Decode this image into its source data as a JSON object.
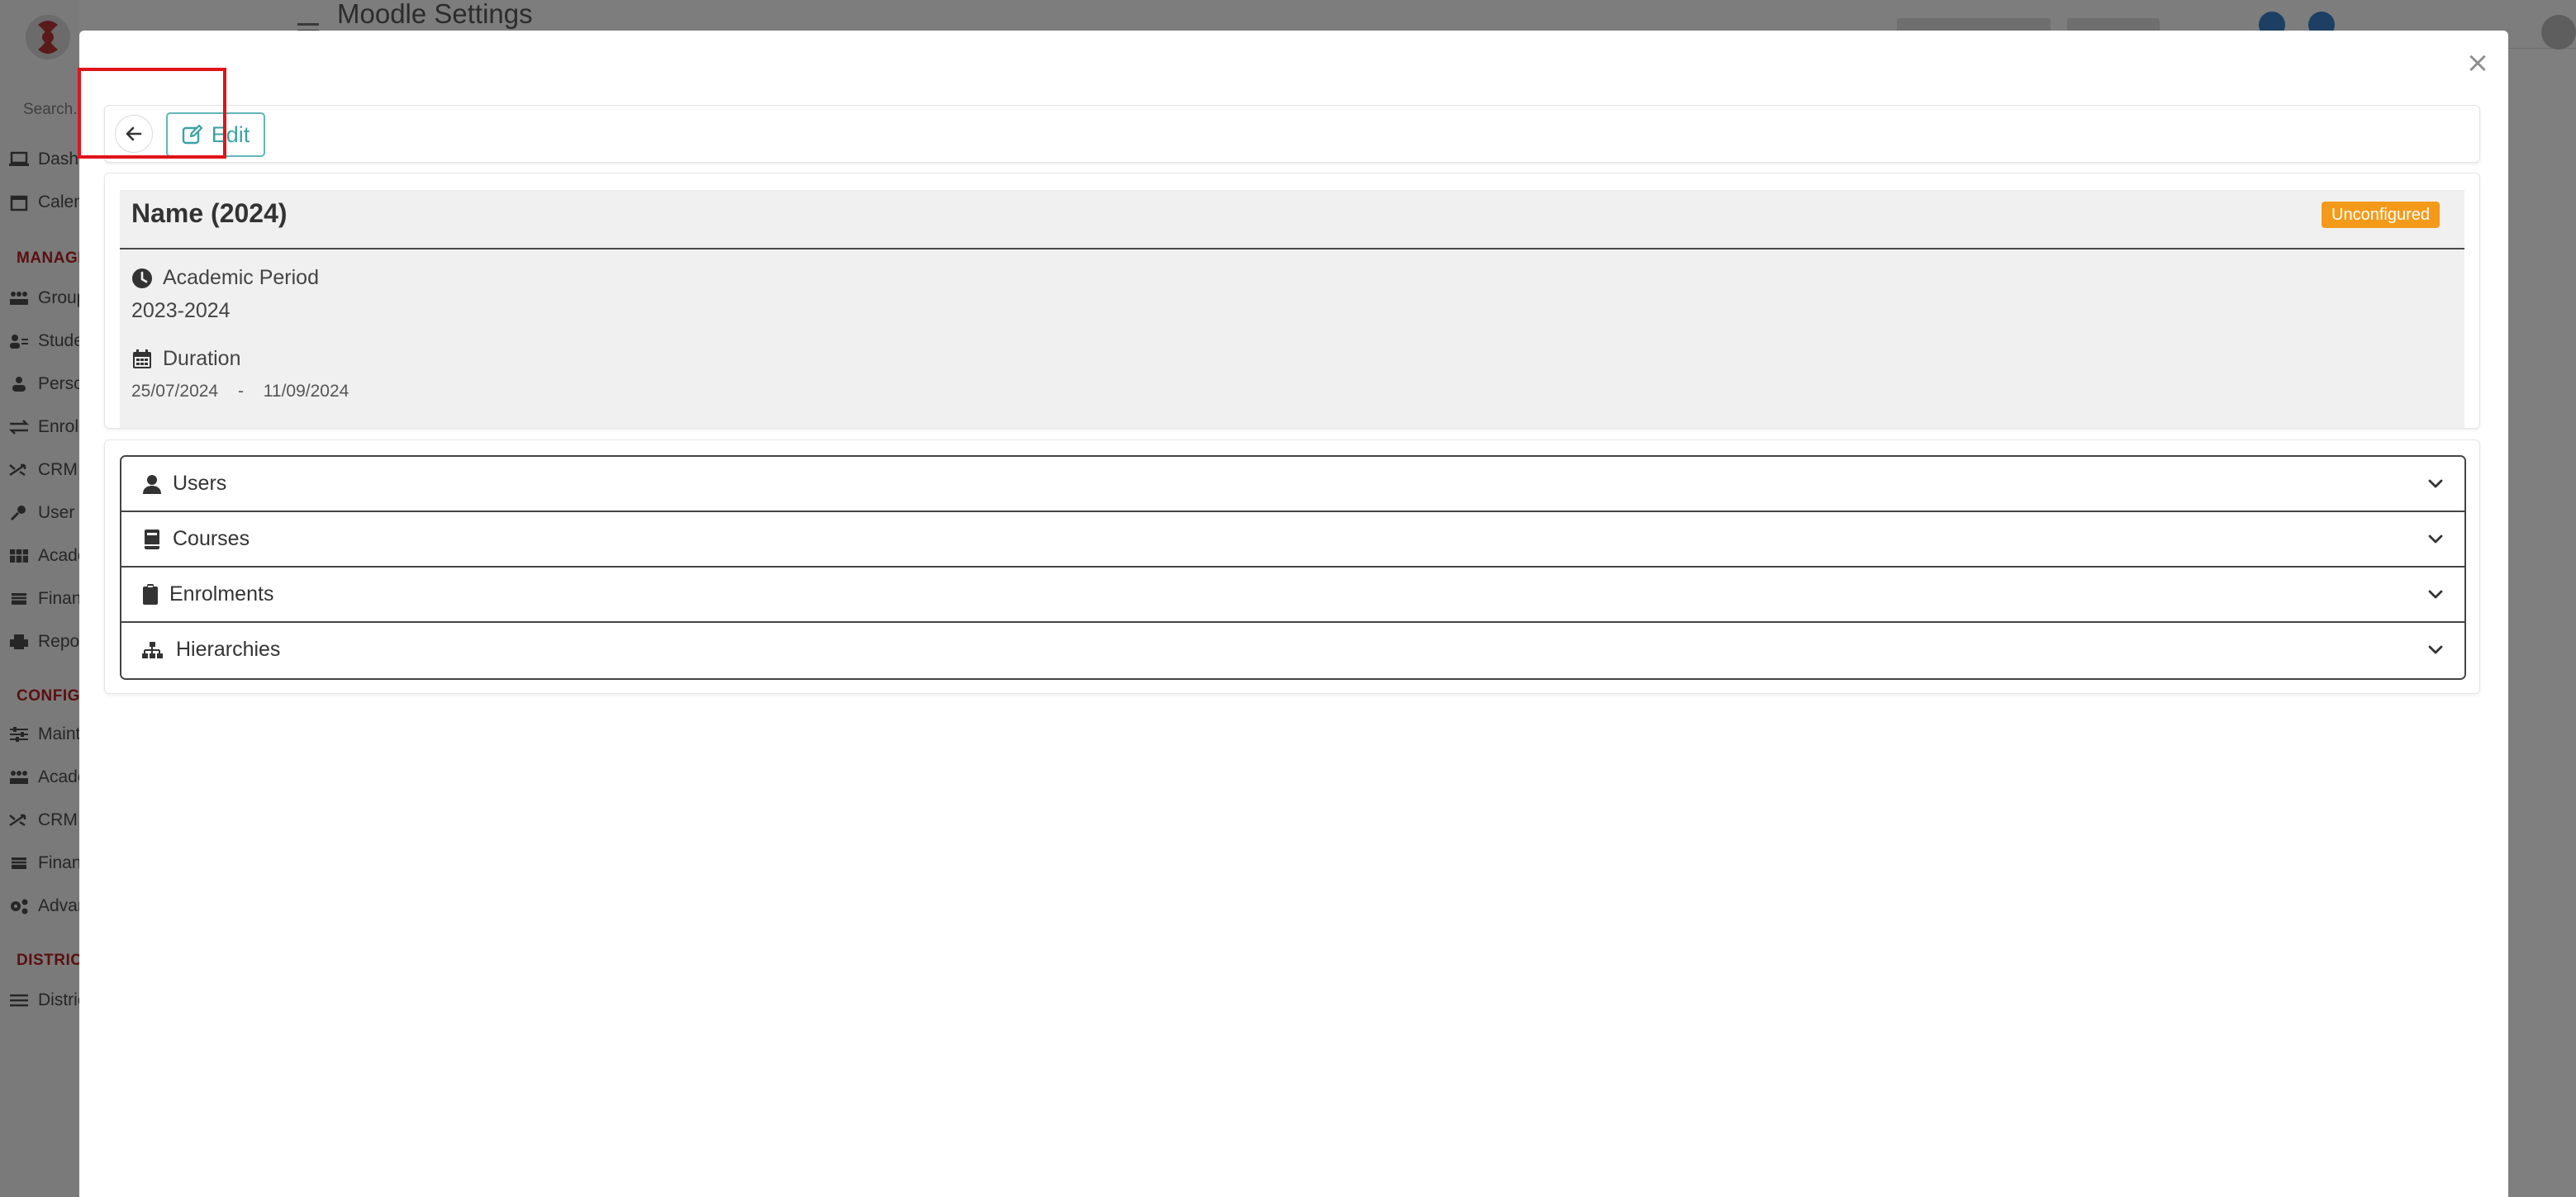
{
  "background": {
    "page_title": "Moodle Settings",
    "search_placeholder": "Search...",
    "nav_items": [
      {
        "label": "Dashboard",
        "icon": "laptop-icon"
      },
      {
        "label": "Calendar",
        "icon": "calendar-icon"
      },
      {
        "label": "Groups",
        "icon": "groups-icon"
      },
      {
        "label": "Students",
        "icon": "students-icon"
      },
      {
        "label": "Persons",
        "icon": "persons-icon"
      },
      {
        "label": "Enrolments",
        "icon": "exchange-icon"
      },
      {
        "label": "CRM",
        "icon": "shuffle-icon"
      },
      {
        "label": "User",
        "icon": "key-icon"
      },
      {
        "label": "Academic",
        "icon": "table-icon"
      },
      {
        "label": "Finance",
        "icon": "cash-icon"
      },
      {
        "label": "Reports",
        "icon": "printer-icon"
      },
      {
        "label": "Maintenance",
        "icon": "sliders-icon"
      },
      {
        "label": "Academic",
        "icon": "groups-icon"
      },
      {
        "label": "CRM",
        "icon": "shuffle-icon"
      },
      {
        "label": "Finance",
        "icon": "cash-icon"
      },
      {
        "label": "Advanced",
        "icon": "cogs-icon"
      },
      {
        "label": "Districts",
        "icon": "list-icon"
      }
    ],
    "sections": [
      "MANAGE",
      "CONFIG",
      "DISTRICTS"
    ]
  },
  "modal": {
    "close_glyph": "×",
    "toolbar": {
      "back_icon": "arrow-left-icon",
      "edit_label": "Edit",
      "edit_icon": "edit-icon"
    },
    "details": {
      "title": "Name (2024)",
      "status": "Unconfigured",
      "status_color": "#f49a1a",
      "academic_period_label": "Academic Period",
      "academic_period_value": "2023-2024",
      "duration_label": "Duration",
      "duration_start": "25/07/2024",
      "duration_separator": "-",
      "duration_end": "11/09/2024"
    },
    "sections": [
      {
        "label": "Users",
        "icon": "user-icon"
      },
      {
        "label": "Courses",
        "icon": "book-icon"
      },
      {
        "label": "Enrolments",
        "icon": "clipboard-icon"
      },
      {
        "label": "Hierarchies",
        "icon": "sitemap-icon"
      }
    ]
  },
  "colors": {
    "accent_teal": "#3aa3a6",
    "highlight_red": "#e0141a",
    "brand_red": "#b3161b"
  }
}
